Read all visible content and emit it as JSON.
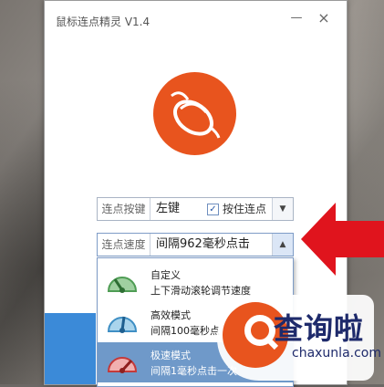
{
  "window": {
    "title": "鼠标连点精灵 V1.4",
    "minimize_glyph": "—",
    "close_glyph": "×"
  },
  "click_key_row": {
    "label": "连点按键",
    "value": "左键",
    "hold_checkbox_checked": true,
    "hold_label": "按住连点"
  },
  "speed_row": {
    "label": "连点速度",
    "value": "间隔962毫秒点击"
  },
  "speed_options": [
    {
      "title": "自定义",
      "description": "上下滑动滚轮调节速度",
      "icon": "gauge-green-icon",
      "selected": false
    },
    {
      "title": "高效模式",
      "description": "间隔100毫秒点",
      "icon": "gauge-blue-icon",
      "selected": false
    },
    {
      "title": "极速模式",
      "description": "间隔1毫秒点击一次",
      "icon": "gauge-red-icon",
      "selected": true
    }
  ],
  "watermark": {
    "title": "查询啦",
    "subtitle": "chaxunla.com"
  },
  "colors": {
    "accent_orange": "#e8541e",
    "selected_row": "#6f99c9",
    "pointer_arrow": "#e0141d"
  }
}
